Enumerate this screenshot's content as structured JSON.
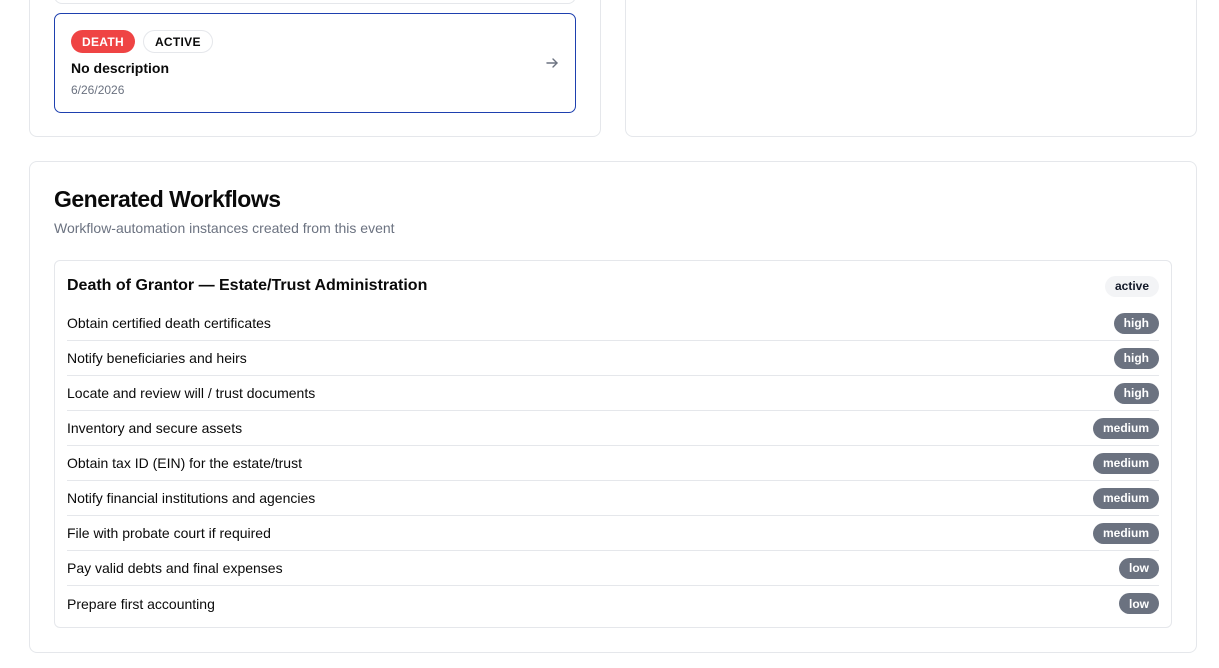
{
  "event": {
    "type_badge": "DEATH",
    "status_badge": "ACTIVE",
    "description": "No description",
    "date": "6/26/2026"
  },
  "workflows": {
    "title": "Generated Workflows",
    "subtitle": "Workflow-automation instances created from this event",
    "instance": {
      "name": "Death of Grantor — Estate/Trust Administration",
      "status": "active",
      "tasks": [
        {
          "label": "Obtain certified death certificates",
          "priority": "high"
        },
        {
          "label": "Notify beneficiaries and heirs",
          "priority": "high"
        },
        {
          "label": "Locate and review will / trust documents",
          "priority": "high"
        },
        {
          "label": "Inventory and secure assets",
          "priority": "medium"
        },
        {
          "label": "Obtain tax ID (EIN) for the estate/trust",
          "priority": "medium"
        },
        {
          "label": "Notify financial institutions and agencies",
          "priority": "medium"
        },
        {
          "label": "File with probate court if required",
          "priority": "medium"
        },
        {
          "label": "Pay valid debts and final expenses",
          "priority": "low"
        },
        {
          "label": "Prepare first accounting",
          "priority": "low"
        }
      ]
    }
  },
  "colors": {
    "death_badge": "#ef4444",
    "selected_border": "#1e40af",
    "priority_badge": "#6b7280"
  },
  "icons": {
    "event_arrow": "arrow-right-icon"
  }
}
